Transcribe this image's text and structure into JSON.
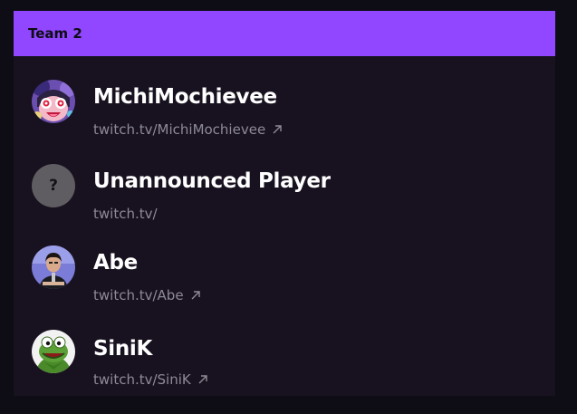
{
  "team": {
    "title": "Team 2",
    "accent_color": "#9147ff"
  },
  "players": [
    {
      "name": "MichiMochievee",
      "link": "twitch.tv/MichiMochievee",
      "has_external_link": true,
      "avatar_icon": "anime-character-avatar"
    },
    {
      "name": "Unannounced Player",
      "link": "twitch.tv/",
      "has_external_link": false,
      "avatar_icon": "question-mark",
      "avatar_text": "?"
    },
    {
      "name": "Abe",
      "link": "twitch.tv/Abe",
      "has_external_link": true,
      "avatar_icon": "person-photo-avatar"
    },
    {
      "name": "SiniK",
      "link": "twitch.tv/SiniK",
      "has_external_link": true,
      "avatar_icon": "frog-puppet-avatar"
    }
  ]
}
